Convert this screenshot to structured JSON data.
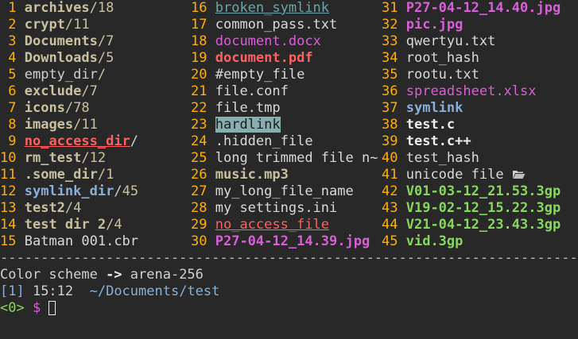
{
  "columns": [
    [
      {
        "num": " 1",
        "name": "archives",
        "suffix": "/",
        "count": "18",
        "style": "dir"
      },
      {
        "num": " 2",
        "name": "crypt",
        "suffix": "/",
        "count": "11",
        "style": "dir"
      },
      {
        "num": " 3",
        "name": "Documents",
        "suffix": "/",
        "count": "7",
        "style": "dir"
      },
      {
        "num": " 4",
        "name": "Downloads",
        "suffix": "/",
        "count": "5",
        "style": "dir"
      },
      {
        "num": " 5",
        "name": "empty_dir",
        "suffix": "/",
        "count": "",
        "style": "plain-dir"
      },
      {
        "num": " 6",
        "name": "exclude",
        "suffix": "/",
        "count": "7",
        "style": "dir"
      },
      {
        "num": " 7",
        "name": "icons",
        "suffix": "/",
        "count": "78",
        "style": "dir"
      },
      {
        "num": " 8",
        "name": "images",
        "suffix": "/",
        "count": "11",
        "style": "dir"
      },
      {
        "num": " 9",
        "name": "no_access_dir",
        "suffix": "/",
        "count": "",
        "style": "noaccess-b"
      },
      {
        "num": "10",
        "name": "rm_test",
        "suffix": "/",
        "count": "12",
        "style": "dir"
      },
      {
        "num": "11",
        "name": ".some_dir",
        "suffix": "/",
        "count": "1",
        "style": "dir"
      },
      {
        "num": "12",
        "name": "symlink_dir",
        "suffix": "/",
        "count": "45",
        "style": "symdir"
      },
      {
        "num": "13",
        "name": "test2",
        "suffix": "/",
        "count": "4",
        "style": "dir"
      },
      {
        "num": "14",
        "name": "test dir 2",
        "suffix": "/",
        "count": "4",
        "style": "dir"
      },
      {
        "num": "15",
        "name": "Batman 001.cbr",
        "suffix": "",
        "count": "",
        "style": "white"
      }
    ],
    [
      {
        "num": "16",
        "name": "broken_symlink",
        "style": "broken"
      },
      {
        "num": "17",
        "name": "common_pass.txt",
        "style": "white"
      },
      {
        "num": "18",
        "name": "document.docx",
        "style": "docx"
      },
      {
        "num": "19",
        "name": "document.pdf",
        "style": "pdf"
      },
      {
        "num": "20",
        "name": "#empty_file",
        "style": "white"
      },
      {
        "num": "21",
        "name": "file.conf",
        "style": "white"
      },
      {
        "num": "22",
        "name": "file.tmp",
        "style": "white"
      },
      {
        "num": "23",
        "name": "hardlink",
        "style": "hardlink"
      },
      {
        "num": "24",
        "name": ".hidden_file",
        "style": "white"
      },
      {
        "num": "25",
        "name": "long trimmed file n~",
        "style": "white"
      },
      {
        "num": "26",
        "name": "music.mp3",
        "style": "mp3"
      },
      {
        "num": "27",
        "name": "my_long_file_name",
        "style": "white"
      },
      {
        "num": "28",
        "name": "my settings.ini",
        "style": "white"
      },
      {
        "num": "29",
        "name": "no_access_file",
        "style": "noaccess"
      },
      {
        "num": "30",
        "name": "P27-04-12_14.39.jpg",
        "style": "img"
      }
    ],
    [
      {
        "num": "31",
        "name": "P27-04-12_14.40.jpg",
        "style": "img"
      },
      {
        "num": "32",
        "name": "pic.jpg",
        "style": "img"
      },
      {
        "num": "33",
        "name": "qwertyu.txt",
        "style": "white"
      },
      {
        "num": "34",
        "name": "root_hash",
        "style": "white"
      },
      {
        "num": "35",
        "name": "rootu.txt",
        "style": "white"
      },
      {
        "num": "36",
        "name": "spreadsheet.xlsx",
        "style": "xlsx"
      },
      {
        "num": "37",
        "name": "symlink",
        "style": "symlink"
      },
      {
        "num": "38",
        "name": "test.c",
        "style": "src"
      },
      {
        "num": "39",
        "name": "test.c++",
        "style": "src"
      },
      {
        "num": "40",
        "name": "test_hash",
        "style": "white"
      },
      {
        "num": "41",
        "name": "unicode file ",
        "style": "white",
        "icon": "open-folder-icon"
      },
      {
        "num": "42",
        "name": "V01-03-12_21.53.3gp",
        "style": "video"
      },
      {
        "num": "43",
        "name": "V19-02-12_15.22.3gp",
        "style": "video"
      },
      {
        "num": "44",
        "name": "V21-04-12_23.43.3gp",
        "style": "video"
      },
      {
        "num": "45",
        "name": "vid.3gp",
        "style": "video"
      }
    ]
  ],
  "divider": "-------------------------------------------------------------------------------------------",
  "status": {
    "scheme_prefix": "Color scheme ",
    "scheme_arrow": "->",
    "scheme_name": " arena-256",
    "context_bracket": "[1]",
    "time": " 15:12 ",
    "path": " ~/Documents/test",
    "prompt_code": "<0>",
    "prompt_dollar": " $ "
  },
  "colors": {
    "background": "#282828",
    "number": "#ffaf00",
    "directory": "#c7c1a0",
    "image": "#d75fd7",
    "video": "#87d75f",
    "symlink": "#87afd7",
    "error": "#ff5f5f"
  }
}
